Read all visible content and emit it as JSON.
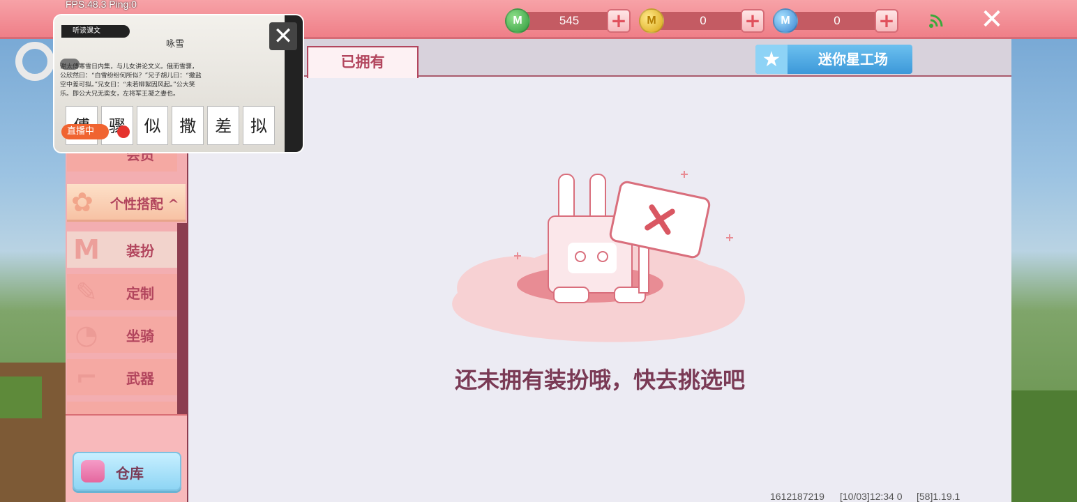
{
  "debug": {
    "fps_text": "FPS:48.3  Ping:0"
  },
  "currencies": [
    {
      "icon": "mini-bean-icon",
      "glyph": "M",
      "value": "545",
      "color": "green"
    },
    {
      "icon": "mini-coin-icon",
      "glyph": "M",
      "value": "0",
      "color": "gold"
    },
    {
      "icon": "mini-point-icon",
      "glyph": "M",
      "value": "0",
      "color": "blue"
    }
  ],
  "topbar": {
    "plus_glyph": "+",
    "close_glyph": "✕"
  },
  "tabs": {
    "owned": "已拥有"
  },
  "mini_workshop": {
    "label": "迷你星工场",
    "star_glyph": "★"
  },
  "sidebar": {
    "category_header": "个性搭配",
    "category_arrow": "^",
    "items": [
      {
        "label": "装扮",
        "icon": "outfit-icon",
        "glyph": "M",
        "active": true
      },
      {
        "label": "定制",
        "icon": "customize-icon",
        "glyph": "✎",
        "active": false
      },
      {
        "label": "坐骑",
        "icon": "mount-icon",
        "glyph": "◔",
        "active": false
      },
      {
        "label": "武器",
        "icon": "weapon-icon",
        "glyph": "⌐",
        "active": false
      }
    ],
    "partial_label": "会员",
    "storage_label": "仓库"
  },
  "empty_state": {
    "message": "还未拥有装扮哦，快去挑选吧"
  },
  "footer": {
    "user_id": "1612187219",
    "datetime": "[10/03]12:34 0",
    "version": "[58]1.19.1"
  },
  "video_overlay": {
    "banner": "听读课文",
    "poem_title": "咏雪",
    "poem_lines": [
      "谢太傅寒雪日内集，与儿女讲论文义。俄而雪骤，",
      "公欣然曰：“白雪纷纷何所似？”兄子胡儿曰：“撒盐",
      "空中差可拟。”兄女曰：“未若柳絮因风起。”公大笑",
      "乐。即公大兄无奕女，左将军王凝之妻也。"
    ],
    "cards": [
      "傅",
      "骤",
      "似",
      "撒",
      "差",
      "拟"
    ],
    "live_label": "直播中",
    "close_glyph": "✕"
  },
  "colors": {
    "topbar": "#ef7f88",
    "accent_text": "#b2455d",
    "empty_text": "#7a3a55",
    "workshop_button": "#3c98d9"
  }
}
